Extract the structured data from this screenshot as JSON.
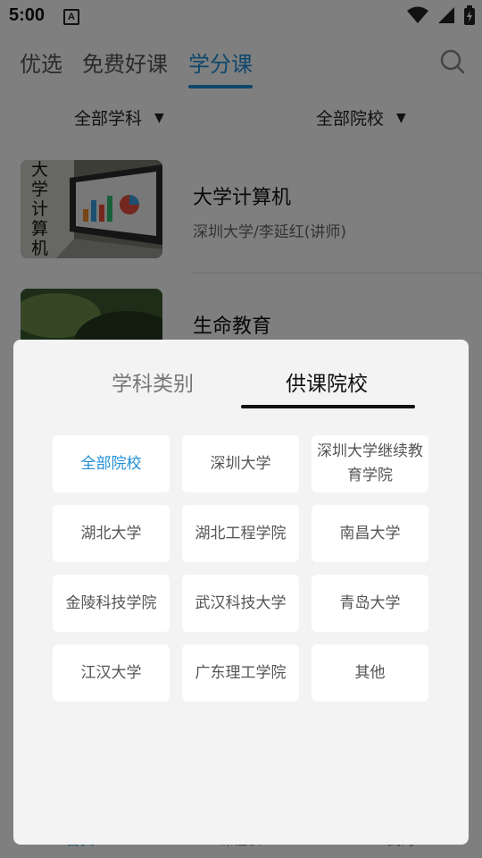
{
  "status_bar": {
    "time": "5:00",
    "notification_letter": "A"
  },
  "top_tabs": [
    {
      "label": "优选"
    },
    {
      "label": "免费好课"
    },
    {
      "label": "学分课",
      "active": true
    }
  ],
  "filters": {
    "subject": "全部学科",
    "school": "全部院校"
  },
  "courses": [
    {
      "title": "大学计算机",
      "subtitle": "深圳大学/李延红(讲师)",
      "thumb_text": "大学计算机"
    },
    {
      "title": "生命教育",
      "subtitle": ""
    }
  ],
  "bottom_nav": [
    {
      "label": "首页"
    },
    {
      "label": "课程表"
    },
    {
      "label": "我的"
    }
  ],
  "filter_sheet": {
    "tabs": [
      {
        "label": "学科类别"
      },
      {
        "label": "供课院校",
        "active": true
      }
    ],
    "options": [
      {
        "label": "全部院校",
        "selected": true
      },
      {
        "label": "深圳大学"
      },
      {
        "label": "深圳大学继续教育学院"
      },
      {
        "label": "湖北大学"
      },
      {
        "label": "湖北工程学院"
      },
      {
        "label": "南昌大学"
      },
      {
        "label": "金陵科技学院"
      },
      {
        "label": "武汉科技大学"
      },
      {
        "label": "青岛大学"
      },
      {
        "label": "江汉大学"
      },
      {
        "label": "广东理工学院"
      },
      {
        "label": "其他"
      }
    ]
  },
  "colors": {
    "accent": "#1f8fd8",
    "sheet_bg": "#f3f3f3",
    "overlay": "rgba(0,0,0,0.5)"
  }
}
